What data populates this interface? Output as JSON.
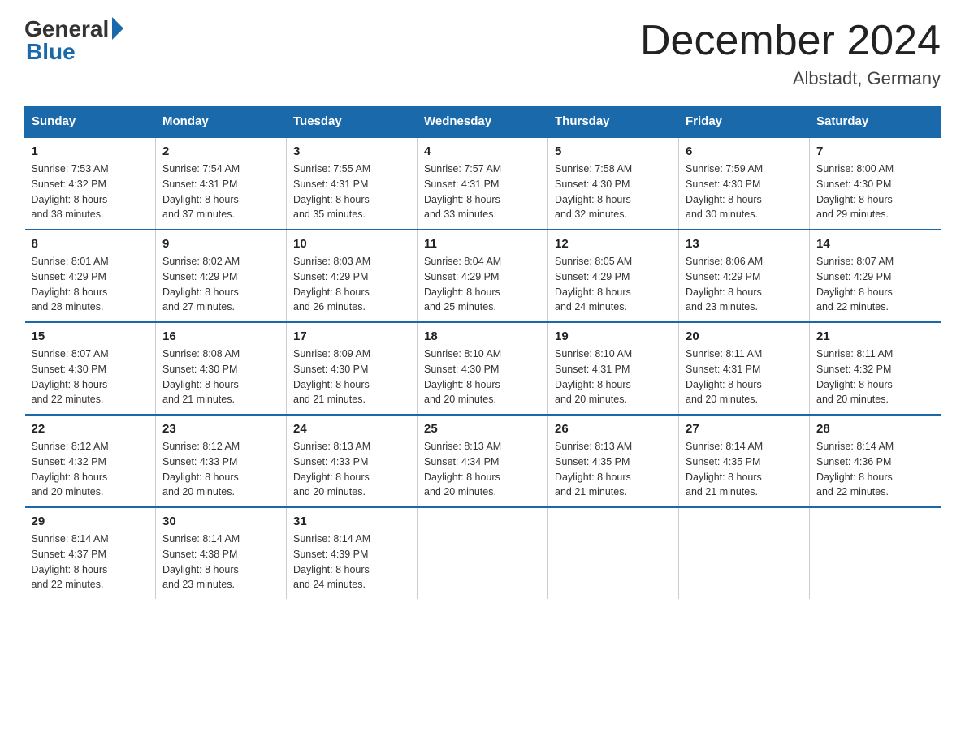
{
  "header": {
    "logo_general": "General",
    "logo_blue": "Blue",
    "title": "December 2024",
    "subtitle": "Albstadt, Germany"
  },
  "days_of_week": [
    "Sunday",
    "Monday",
    "Tuesday",
    "Wednesday",
    "Thursday",
    "Friday",
    "Saturday"
  ],
  "weeks": [
    [
      {
        "day": "1",
        "info": "Sunrise: 7:53 AM\nSunset: 4:32 PM\nDaylight: 8 hours\nand 38 minutes."
      },
      {
        "day": "2",
        "info": "Sunrise: 7:54 AM\nSunset: 4:31 PM\nDaylight: 8 hours\nand 37 minutes."
      },
      {
        "day": "3",
        "info": "Sunrise: 7:55 AM\nSunset: 4:31 PM\nDaylight: 8 hours\nand 35 minutes."
      },
      {
        "day": "4",
        "info": "Sunrise: 7:57 AM\nSunset: 4:31 PM\nDaylight: 8 hours\nand 33 minutes."
      },
      {
        "day": "5",
        "info": "Sunrise: 7:58 AM\nSunset: 4:30 PM\nDaylight: 8 hours\nand 32 minutes."
      },
      {
        "day": "6",
        "info": "Sunrise: 7:59 AM\nSunset: 4:30 PM\nDaylight: 8 hours\nand 30 minutes."
      },
      {
        "day": "7",
        "info": "Sunrise: 8:00 AM\nSunset: 4:30 PM\nDaylight: 8 hours\nand 29 minutes."
      }
    ],
    [
      {
        "day": "8",
        "info": "Sunrise: 8:01 AM\nSunset: 4:29 PM\nDaylight: 8 hours\nand 28 minutes."
      },
      {
        "day": "9",
        "info": "Sunrise: 8:02 AM\nSunset: 4:29 PM\nDaylight: 8 hours\nand 27 minutes."
      },
      {
        "day": "10",
        "info": "Sunrise: 8:03 AM\nSunset: 4:29 PM\nDaylight: 8 hours\nand 26 minutes."
      },
      {
        "day": "11",
        "info": "Sunrise: 8:04 AM\nSunset: 4:29 PM\nDaylight: 8 hours\nand 25 minutes."
      },
      {
        "day": "12",
        "info": "Sunrise: 8:05 AM\nSunset: 4:29 PM\nDaylight: 8 hours\nand 24 minutes."
      },
      {
        "day": "13",
        "info": "Sunrise: 8:06 AM\nSunset: 4:29 PM\nDaylight: 8 hours\nand 23 minutes."
      },
      {
        "day": "14",
        "info": "Sunrise: 8:07 AM\nSunset: 4:29 PM\nDaylight: 8 hours\nand 22 minutes."
      }
    ],
    [
      {
        "day": "15",
        "info": "Sunrise: 8:07 AM\nSunset: 4:30 PM\nDaylight: 8 hours\nand 22 minutes."
      },
      {
        "day": "16",
        "info": "Sunrise: 8:08 AM\nSunset: 4:30 PM\nDaylight: 8 hours\nand 21 minutes."
      },
      {
        "day": "17",
        "info": "Sunrise: 8:09 AM\nSunset: 4:30 PM\nDaylight: 8 hours\nand 21 minutes."
      },
      {
        "day": "18",
        "info": "Sunrise: 8:10 AM\nSunset: 4:30 PM\nDaylight: 8 hours\nand 20 minutes."
      },
      {
        "day": "19",
        "info": "Sunrise: 8:10 AM\nSunset: 4:31 PM\nDaylight: 8 hours\nand 20 minutes."
      },
      {
        "day": "20",
        "info": "Sunrise: 8:11 AM\nSunset: 4:31 PM\nDaylight: 8 hours\nand 20 minutes."
      },
      {
        "day": "21",
        "info": "Sunrise: 8:11 AM\nSunset: 4:32 PM\nDaylight: 8 hours\nand 20 minutes."
      }
    ],
    [
      {
        "day": "22",
        "info": "Sunrise: 8:12 AM\nSunset: 4:32 PM\nDaylight: 8 hours\nand 20 minutes."
      },
      {
        "day": "23",
        "info": "Sunrise: 8:12 AM\nSunset: 4:33 PM\nDaylight: 8 hours\nand 20 minutes."
      },
      {
        "day": "24",
        "info": "Sunrise: 8:13 AM\nSunset: 4:33 PM\nDaylight: 8 hours\nand 20 minutes."
      },
      {
        "day": "25",
        "info": "Sunrise: 8:13 AM\nSunset: 4:34 PM\nDaylight: 8 hours\nand 20 minutes."
      },
      {
        "day": "26",
        "info": "Sunrise: 8:13 AM\nSunset: 4:35 PM\nDaylight: 8 hours\nand 21 minutes."
      },
      {
        "day": "27",
        "info": "Sunrise: 8:14 AM\nSunset: 4:35 PM\nDaylight: 8 hours\nand 21 minutes."
      },
      {
        "day": "28",
        "info": "Sunrise: 8:14 AM\nSunset: 4:36 PM\nDaylight: 8 hours\nand 22 minutes."
      }
    ],
    [
      {
        "day": "29",
        "info": "Sunrise: 8:14 AM\nSunset: 4:37 PM\nDaylight: 8 hours\nand 22 minutes."
      },
      {
        "day": "30",
        "info": "Sunrise: 8:14 AM\nSunset: 4:38 PM\nDaylight: 8 hours\nand 23 minutes."
      },
      {
        "day": "31",
        "info": "Sunrise: 8:14 AM\nSunset: 4:39 PM\nDaylight: 8 hours\nand 24 minutes."
      },
      null,
      null,
      null,
      null
    ]
  ]
}
